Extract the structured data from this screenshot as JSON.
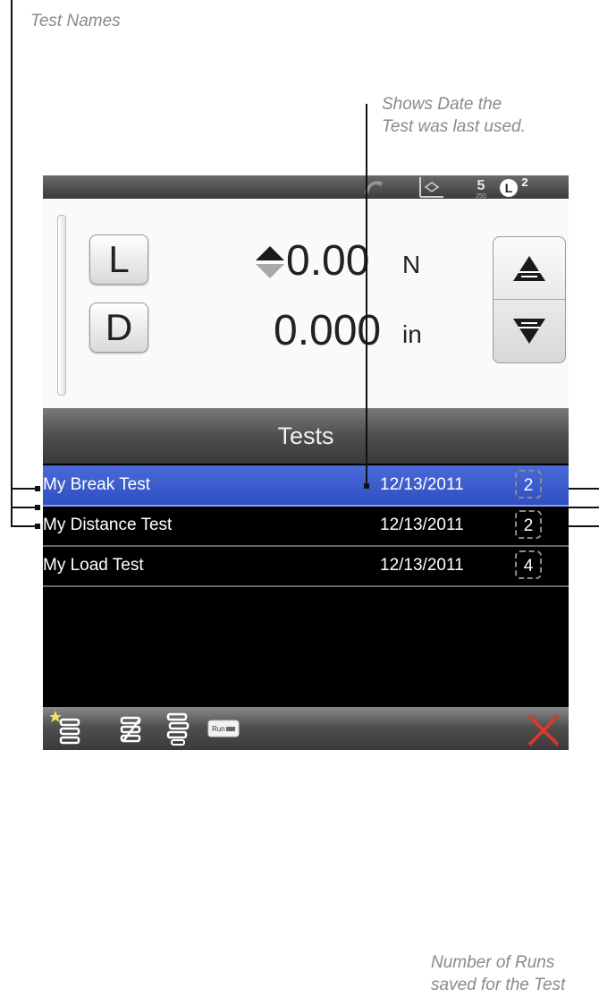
{
  "annotations": {
    "test_names": "Test Names",
    "date_line1": "Shows Date the",
    "date_line2": "Test was last used.",
    "runs_line1": "Number of Runs",
    "runs_line2": "saved for the Test"
  },
  "status_icons": [
    "undo-icon",
    "crosshead-icon",
    "setpoint-icon",
    "limit-icon"
  ],
  "status": {
    "setpoint_label": "250",
    "limit_letter": "L",
    "limit_count": "2"
  },
  "readout": {
    "load_button": "L",
    "distance_button": "D",
    "load_value": "0.00",
    "load_unit": "N",
    "distance_value": "0.000",
    "distance_unit": "in"
  },
  "tests": {
    "title": "Tests",
    "rows": [
      {
        "name": "My Break Test",
        "date": "12/13/2011",
        "runs": "2",
        "selected": true
      },
      {
        "name": "My Distance Test",
        "date": "12/13/2011",
        "runs": "2",
        "selected": false
      },
      {
        "name": "My Load Test",
        "date": "12/13/2011",
        "runs": "4",
        "selected": false
      }
    ]
  },
  "toolbar": {
    "icons": [
      "new-test-icon",
      "edit-test-icon",
      "test-list-icon",
      "run-icon",
      "close-icon"
    ],
    "run_label": "Run",
    "close_color": "#d63a2a"
  },
  "colors": {
    "selected_row": "#3a5acf",
    "annotation_text": "#8a8a8a"
  }
}
